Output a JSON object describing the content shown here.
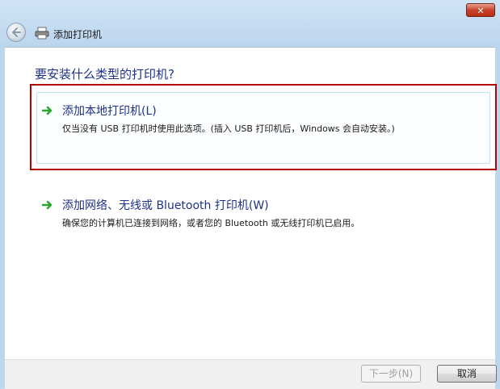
{
  "window": {
    "title": "添加打印机",
    "close_glyph": "✕"
  },
  "content": {
    "heading": "要安装什么类型的打印机?",
    "options": [
      {
        "title": "添加本地打印机(L)",
        "description": "仅当没有 USB 打印机时使用此选项。(插入 USB 打印机后，Windows 会自动安装。)",
        "icon": "green-arrow-icon",
        "selected": true
      },
      {
        "title": "添加网络、无线或 Bluetooth 打印机(W)",
        "description": "确保您的计算机已连接到网络，或者您的 Bluetooth 或无线打印机已启用。",
        "icon": "green-arrow-icon",
        "selected": false
      }
    ]
  },
  "footer": {
    "next_label": "下一步(N)",
    "next_enabled": false,
    "cancel_label": "取消"
  },
  "colors": {
    "accent_text": "#1e3287",
    "selection_frame": "#b40000",
    "arrow": "#2aa52a"
  }
}
